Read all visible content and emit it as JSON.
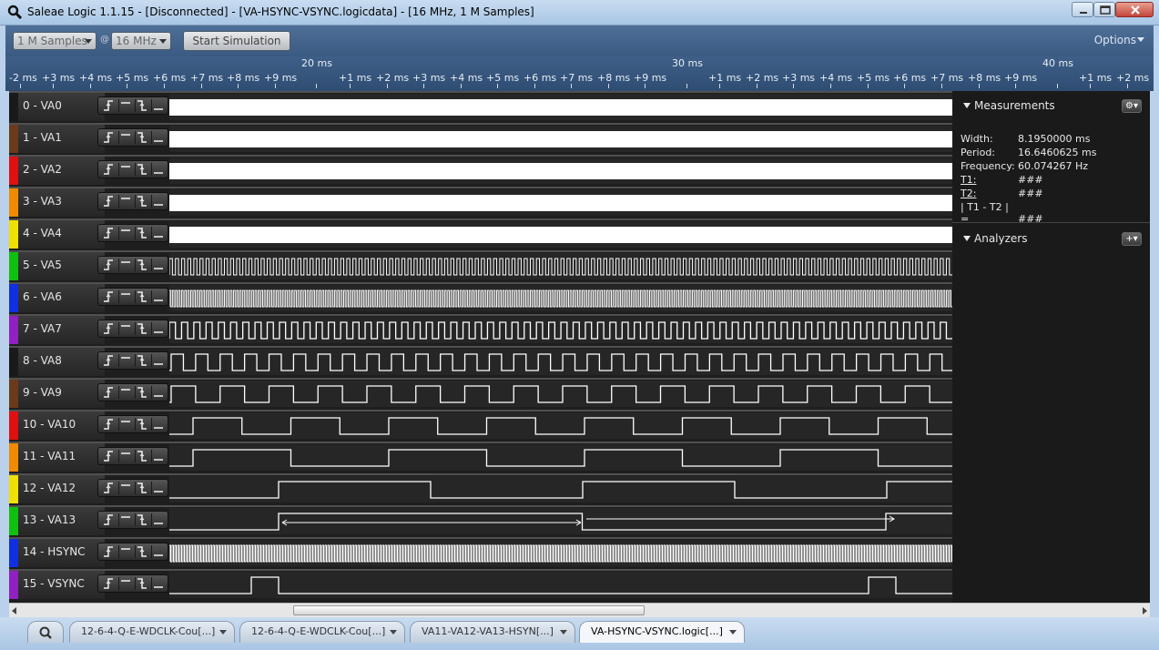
{
  "window": {
    "title": "Saleae Logic 1.1.15 - [Disconnected] - [VA-HSYNC-VSYNC.logicdata] - [16 MHz, 1 M Samples]"
  },
  "toolbar": {
    "samples_value": "1 M Samples",
    "at": "@",
    "rate_value": "16 MHz",
    "start_label": "Start Simulation",
    "options_label": "Options"
  },
  "timeline": {
    "major": [
      "20 ms",
      "30 ms",
      "40 ms"
    ],
    "minor": [
      "-2 ms",
      "+3 ms",
      "+4 ms",
      "+5 ms",
      "+6 ms",
      "+7 ms",
      "+8 ms",
      "+9 ms",
      "+1 ms",
      "+2 ms",
      "+3 ms",
      "+4 ms",
      "+5 ms",
      "+6 ms",
      "+7 ms",
      "+8 ms",
      "+9 ms",
      "+1 ms",
      "+2 ms",
      "+3 ms",
      "+4 ms",
      "+5 ms",
      "+6 ms",
      "+7 ms",
      "+8 ms",
      "+9 ms",
      "+1 ms",
      "+2 ms"
    ]
  },
  "channels": [
    {
      "label": "0 - VA0",
      "color": "#1a1a1a"
    },
    {
      "label": "1 - VA1",
      "color": "#6b3a1a"
    },
    {
      "label": "2 - VA2",
      "color": "#e01010"
    },
    {
      "label": "3 - VA3",
      "color": "#f08a00"
    },
    {
      "label": "4 - VA4",
      "color": "#f0e000"
    },
    {
      "label": "5 - VA5",
      "color": "#10c010"
    },
    {
      "label": "6 - VA6",
      "color": "#1030e0"
    },
    {
      "label": "7 - VA7",
      "color": "#9020c0"
    },
    {
      "label": "8 - VA8",
      "color": "#1a1a1a"
    },
    {
      "label": "9 - VA9",
      "color": "#6b3a1a"
    },
    {
      "label": "10 - VA10",
      "color": "#e01010"
    },
    {
      "label": "11 - VA11",
      "color": "#f08a00"
    },
    {
      "label": "12 - VA12",
      "color": "#f0e000"
    },
    {
      "label": "13 - VA13",
      "color": "#10c010"
    },
    {
      "label": "14 - HSYNC",
      "color": "#1030e0"
    },
    {
      "label": "15 - VSYNC",
      "color": "#9020c0"
    }
  ],
  "measurements": {
    "title": "Measurements",
    "rows": [
      {
        "key": "Width:",
        "value": "8.1950000 ms"
      },
      {
        "key": "Period:",
        "value": "16.6460625 ms"
      },
      {
        "key": "Frequency:",
        "value": "60.074267 Hz"
      },
      {
        "key": "T1:",
        "value": "###"
      },
      {
        "key": "T2:",
        "value": "###"
      },
      {
        "key": "| T1 - T2 | =",
        "value": "###"
      }
    ]
  },
  "analyzers": {
    "title": "Analyzers"
  },
  "tabs": [
    "12-6-4-Q-E-WDCLK-Cou[...]",
    "12-6-4-Q-E-WDCLK-Cou[...]",
    "VA11-VA12-VA13-HSYN[...]",
    "VA-HSYNC-VSYNC.logic[...]"
  ]
}
